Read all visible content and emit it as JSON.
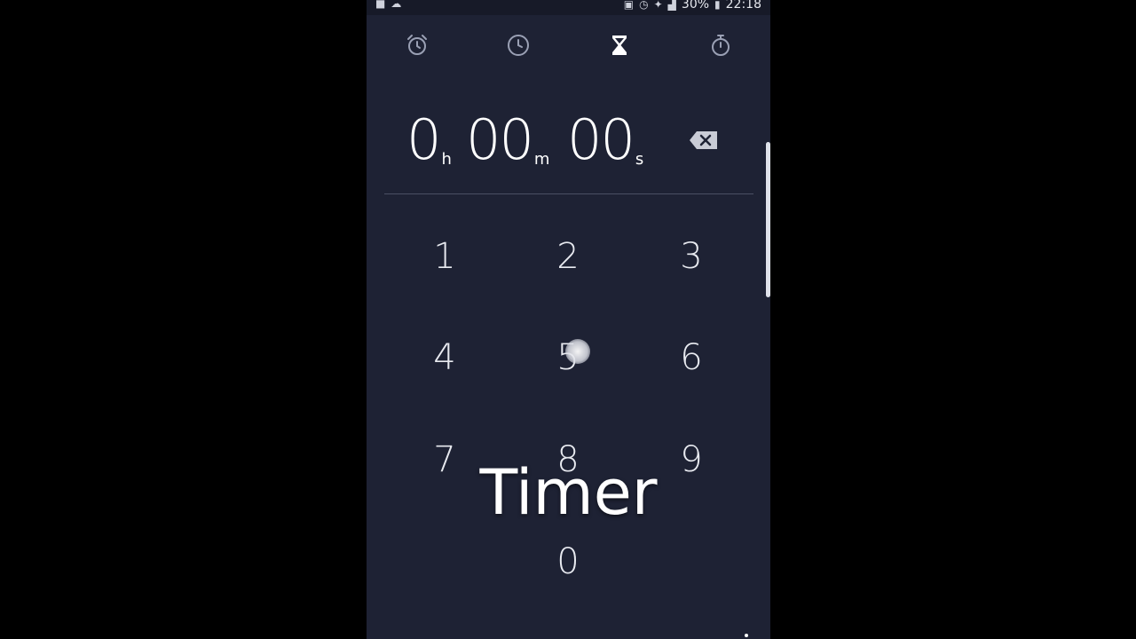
{
  "status_bar": {
    "battery_percent": "30%",
    "time": "22:18"
  },
  "tabs": [
    {
      "id": "alarm",
      "icon": "alarm-clock-icon",
      "active": false
    },
    {
      "id": "world-clock",
      "icon": "clock-icon",
      "active": false
    },
    {
      "id": "timer",
      "icon": "hourglass-icon",
      "active": true
    },
    {
      "id": "stopwatch",
      "icon": "stopwatch-icon",
      "active": false
    }
  ],
  "timer_display": {
    "hours": "0",
    "hours_unit": "h",
    "minutes": "00",
    "minutes_unit": "m",
    "seconds": "00",
    "seconds_unit": "s"
  },
  "keypad": {
    "keys": [
      "1",
      "2",
      "3",
      "4",
      "5",
      "6",
      "7",
      "8",
      "9",
      "0"
    ]
  },
  "caption": "Timer",
  "colors": {
    "background": "#1e2234",
    "status_bar": "#171a28",
    "active_icon": "#ffffff",
    "inactive_icon": "#9aa0b4",
    "divider": "#4a4f63"
  }
}
